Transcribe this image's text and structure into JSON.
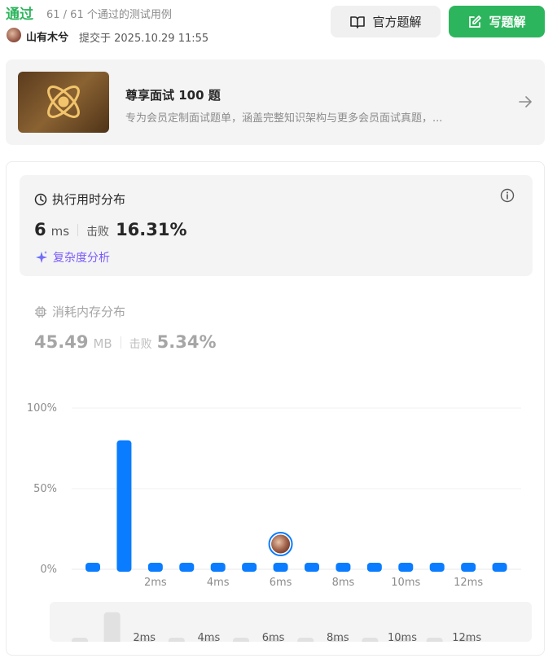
{
  "header": {
    "status": "通过",
    "test_count": "61 / 61 个通过的测试用例",
    "user_name": "山有木兮",
    "submit_time": "提交于 2025.10.29 11:55",
    "official_solution_label": "官方题解",
    "write_solution_label": "写题解"
  },
  "promo": {
    "title": "尊享面试 100 题",
    "description": "专为会员定制面试题单，涵盖完整知识架构与更多会员面试真题，..."
  },
  "runtime": {
    "title": "执行用时分布",
    "value": "6",
    "unit": "ms",
    "beat_label": "击败",
    "beat_pct": "16.31%",
    "complexity_label": "复杂度分析"
  },
  "memory": {
    "title": "消耗内存分布",
    "value": "45.49",
    "unit": "MB",
    "beat_label": "击败",
    "beat_pct": "5.34%"
  },
  "colors": {
    "accent_green": "#2db55d",
    "bar_blue": "#0a7cff",
    "ai_purple": "#7a5af8"
  },
  "chart_data": {
    "type": "bar",
    "yticks": [
      "100%",
      "50%",
      "0%"
    ],
    "xticks": [
      "2ms",
      "4ms",
      "6ms",
      "8ms",
      "10ms",
      "12ms"
    ],
    "ylim": [
      0,
      100
    ],
    "values": [
      1,
      80,
      1,
      1,
      1,
      1,
      1,
      1,
      1,
      1,
      1,
      1,
      1,
      1
    ],
    "highlight_index": 6,
    "grid": true,
    "mini_xticks": [
      "2ms",
      "4ms",
      "6ms",
      "8ms",
      "10ms",
      "12ms"
    ],
    "mini_values": [
      1,
      80,
      1,
      1,
      1,
      1,
      1,
      1,
      1,
      1,
      1,
      1,
      1
    ]
  }
}
